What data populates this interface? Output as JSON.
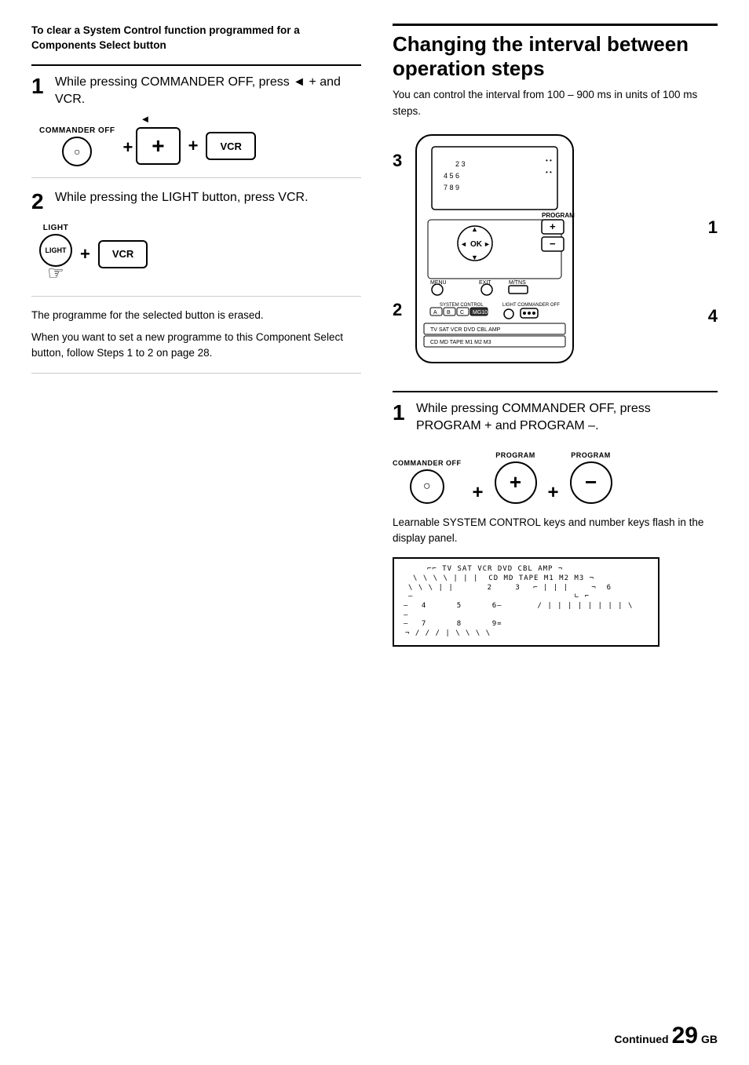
{
  "left": {
    "section_title": "To clear a System Control function programmed for a Components Select button",
    "step1": {
      "number": "1",
      "text": "While pressing COMMANDER OFF, press ◄ + and VCR."
    },
    "step1_diagram": {
      "label1": "COMMANDER OFF",
      "plus1": "+",
      "plus2": "+",
      "vcr": "VCR"
    },
    "step2": {
      "number": "2",
      "text": "While pressing the LIGHT button, press VCR."
    },
    "step2_diagram": {
      "label1": "LIGHT",
      "plus1": "+",
      "vcr": "VCR"
    },
    "desc1": "The programme for the selected button is erased.",
    "desc2": "When you want to set a new programme to this Component Select button, follow Steps 1 to 2 on page 28."
  },
  "right": {
    "main_heading": "Changing the interval between operation steps",
    "intro_text": "You can control the interval from 100 – 900 ms in units of 100 ms steps.",
    "step1": {
      "number": "1",
      "text": "While pressing COMMANDER OFF, press PROGRAM + and PROGRAM –."
    },
    "step1_diagram": {
      "label_commander": "COMMANDER OFF",
      "label_program1": "PROGRAM",
      "label_program2": "PROGRAM",
      "plus1": "+",
      "plus2": "+"
    },
    "desc1": "Learnable SYSTEM CONTROL keys and number keys flash in the display panel.",
    "diagram_labels": {
      "label1": "1",
      "label2": "2",
      "label3": "3",
      "label4": "4"
    }
  },
  "footer": {
    "continued": "Continued",
    "page_number": "29",
    "page_suffix": "GB"
  }
}
